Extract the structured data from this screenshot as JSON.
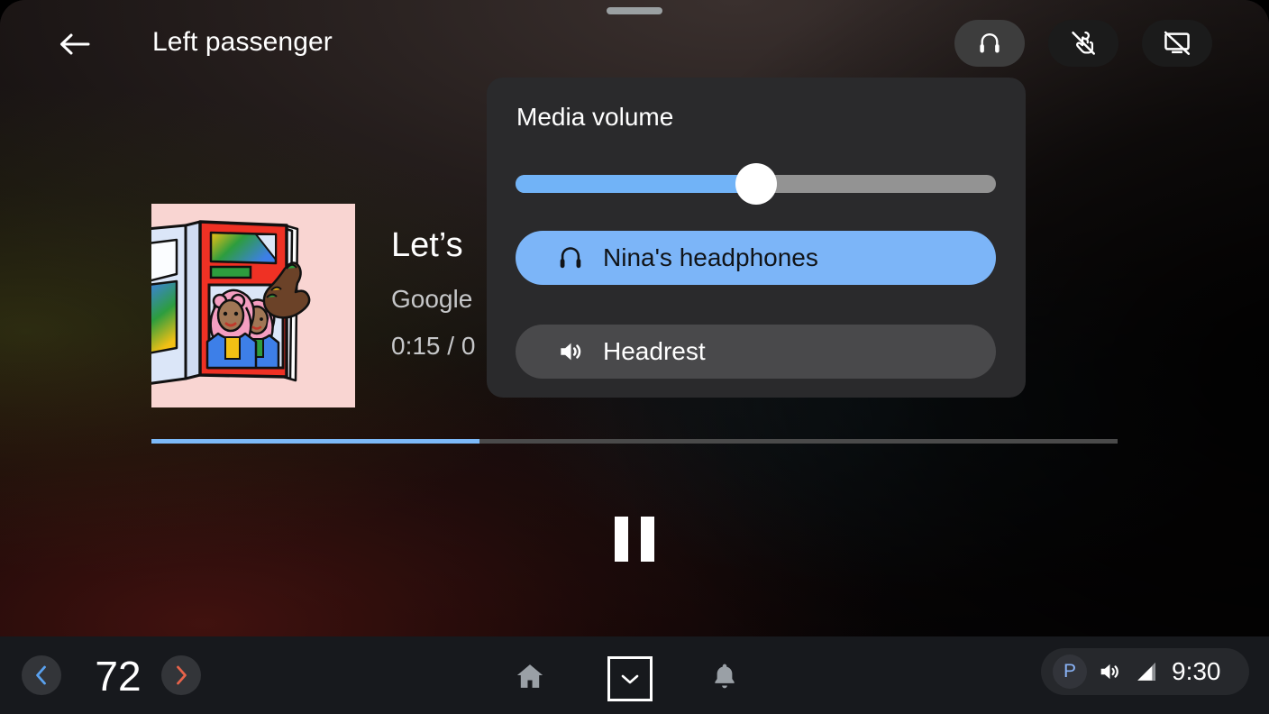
{
  "app": {
    "title": "Left passenger",
    "back_icon": "arrow-left-icon",
    "drag_handle": "drag-handle"
  },
  "top_bar": {
    "chips": [
      {
        "name": "headphones-icon",
        "label": "Headphones",
        "active": true
      },
      {
        "name": "touch-off-icon",
        "label": "Touch disabled",
        "active": false
      },
      {
        "name": "screen-off-icon",
        "label": "Screen off",
        "active": false
      }
    ]
  },
  "media": {
    "title": "Let’s",
    "subtitle": "Google",
    "time": "0:15 / 0",
    "progress_percent": 34,
    "playback_state": "playing",
    "pause_icon": "pause-icon",
    "album_art": {
      "name": "album-art",
      "background": "#f9d5d2",
      "description": "Illustration of a hand holding an open magazine showing two women with pink hair in blue jackets"
    }
  },
  "volume_popup": {
    "title": "Media volume",
    "slider": {
      "name": "media-volume-slider",
      "value_percent": 50,
      "fill_color": "#71b3f7",
      "track_color": "#939393",
      "thumb_color": "#ffffff"
    },
    "devices": [
      {
        "label": "Nina's headphones",
        "icon": "headphones-icon",
        "selected": true,
        "color": "#7cb5f8"
      },
      {
        "label": "Headrest",
        "icon": "speaker-icon",
        "selected": false,
        "color": "#49494b"
      }
    ]
  },
  "bottom_bar": {
    "temperature": {
      "value": "72",
      "decrease_icon": "chevron-left-icon",
      "increase_icon": "chevron-right-icon",
      "decrease_color": "#5aa2f0",
      "increase_color": "#e8634a"
    },
    "nav": [
      {
        "name": "home-icon",
        "label": "Home",
        "active": false
      },
      {
        "name": "apps-chevron-down-icon",
        "label": "Apps",
        "active": true
      },
      {
        "name": "bell-icon",
        "label": "Notifications",
        "active": false
      }
    ],
    "status": {
      "gear": "P",
      "gear_color": "#8ab4f8",
      "volume_icon": "volume-up-icon",
      "signal_icon": "signal-bars-icon",
      "time": "9:30"
    }
  },
  "colors": {
    "accent_blue": "#7cb9f8",
    "panel_bg": "#2a2a2c",
    "system_bar_bg": "#17191d"
  }
}
